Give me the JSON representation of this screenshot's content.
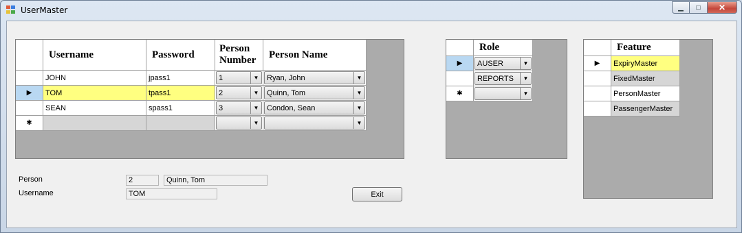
{
  "window": {
    "title": "UserMaster",
    "buttons": {
      "minimize": "▁",
      "maximize": "□",
      "close": "✕"
    }
  },
  "users_grid": {
    "columns": [
      "Username",
      "Password",
      "Person\nNumber",
      "Person Name"
    ],
    "rows": [
      {
        "username": "JOHN",
        "password": "jpass1",
        "person_number": "1",
        "person_name": "Ryan, John"
      },
      {
        "username": "TOM",
        "password": "tpass1",
        "person_number": "2",
        "person_name": "Quinn, Tom"
      },
      {
        "username": "SEAN",
        "password": "spass1",
        "person_number": "3",
        "person_name": "Condon, Sean"
      }
    ],
    "current_row_marker": "▶",
    "new_row_marker": "✱"
  },
  "role_grid": {
    "column": "Role",
    "rows": [
      "AUSER",
      "REPORTS"
    ]
  },
  "feature_grid": {
    "column": "Feature",
    "rows": [
      "ExpiryMaster",
      "FixedMaster",
      "PersonMaster",
      "PassengerMaster"
    ]
  },
  "details": {
    "person_label": "Person",
    "person_number": "2",
    "person_name": "Quinn, Tom",
    "username_label": "Username",
    "username": "TOM"
  },
  "exit_button": "Exit",
  "colors": {
    "selection": "#ffff80",
    "current_row_header": "#b9d8f2",
    "grid_background": "#ababab"
  }
}
